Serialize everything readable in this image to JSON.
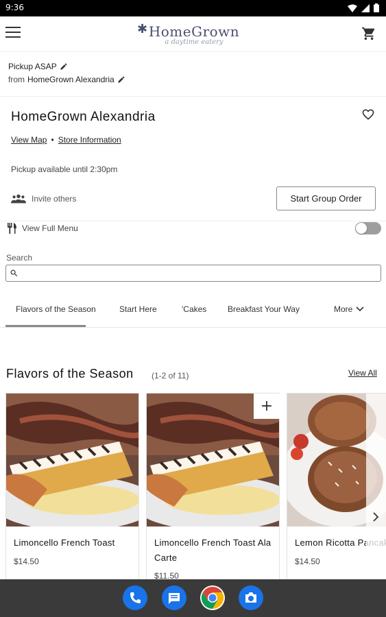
{
  "status_bar": {
    "time": "9:36"
  },
  "header": {
    "brand": "HomeGrown",
    "tagline": "a daytime eatery"
  },
  "pickup": {
    "time_text": "Pickup ASAP",
    "from_prefix": "from",
    "location": "HomeGrown Alexandria"
  },
  "store": {
    "name": "HomeGrown Alexandria",
    "view_map": "View Map",
    "separator": "•",
    "store_info": "Store Information",
    "availability": "Pickup available until 2:30pm",
    "invite": "Invite others",
    "group_order": "Start Group Order",
    "full_menu": "View Full Menu"
  },
  "search": {
    "label": "Search",
    "value": ""
  },
  "tabs": [
    {
      "label": "Flavors of the Season"
    },
    {
      "label": "Start Here"
    },
    {
      "label": "'Cakes"
    },
    {
      "label": "Breakfast Your Way"
    },
    {
      "label": "More"
    }
  ],
  "section": {
    "title": "Flavors of the Season",
    "count": "(1-2 of 11)",
    "view_all": "View All"
  },
  "items": [
    {
      "name": "Limoncello French Toast",
      "price": "$14.50"
    },
    {
      "name": "Limoncello French Toast Ala Carte",
      "price": "$11.50"
    },
    {
      "name": "Lemon Ricotta Pancakes",
      "price": "$14.50"
    }
  ],
  "icons": {
    "menu": "hamburger-menu-icon",
    "cart": "shopping-cart-icon",
    "edit": "pencil-icon",
    "favorite": "heart-icon",
    "people": "people-icon",
    "utensils": "fork-knife-icon",
    "search": "magnifier-icon",
    "dock": [
      "phone-icon",
      "messages-icon",
      "chrome-icon",
      "camera-icon"
    ]
  },
  "colors": {
    "brand": "#4a4f72",
    "dock_blue": "#1a73e8",
    "navbar": "#3a3a3a"
  }
}
